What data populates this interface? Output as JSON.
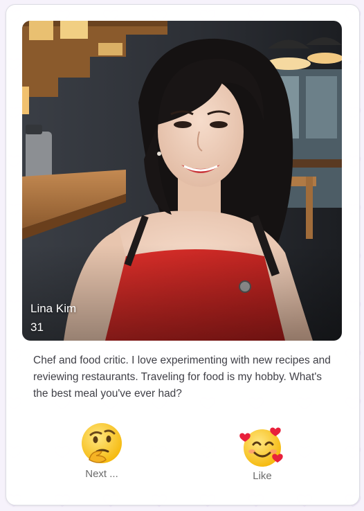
{
  "profile": {
    "name": "Lina Kim",
    "age": "31",
    "bio": "Chef and food critic. I love experimenting with new recipes and reviewing restaurants. Traveling for food is my hobby. What's the best meal you've ever had?"
  },
  "actions": {
    "next_label": "Next ...",
    "next_icon": "thinking-face-icon",
    "like_label": "Like",
    "like_icon": "smiling-face-with-hearts-icon"
  },
  "colors": {
    "accent_red": "#d32020",
    "page_background": "#f6f2fb",
    "text": "#3f3f46"
  }
}
